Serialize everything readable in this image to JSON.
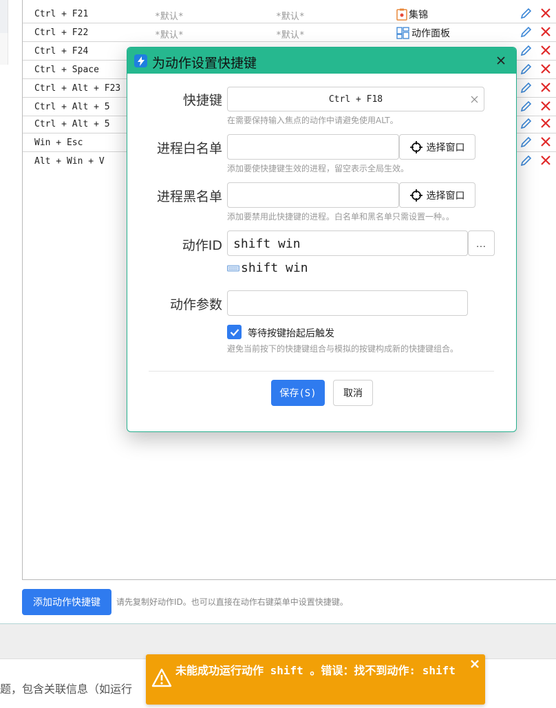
{
  "rows": [
    {
      "key": "Ctrl + F21",
      "default1": "*默认*",
      "default2": "*默认*",
      "action": "集锦",
      "action_icon": "clipboard-icon"
    },
    {
      "key": "Ctrl + F22",
      "default1": "*默认*",
      "default2": "*默认*",
      "action": "动作面板",
      "action_icon": "panel-icon"
    },
    {
      "key": "Ctrl + F24"
    },
    {
      "key": "Ctrl + Space"
    },
    {
      "key": "Ctrl + Alt + F23"
    },
    {
      "key": "Ctrl + Alt + 5"
    },
    {
      "key": "Ctrl + Alt + 5"
    },
    {
      "key": "Win + Esc"
    },
    {
      "key": "Alt + Win + V"
    }
  ],
  "bottom": {
    "add_button": "添加动作快捷键",
    "add_hint": "请先复制好动作ID。也可以直接在动作右键菜单中设置快捷键。",
    "input_text": "题，包含关联信息（如运行"
  },
  "dialog": {
    "title": "为动作设置快捷键",
    "hotkey_label": "快捷键",
    "hotkey_value": "Ctrl + F18",
    "hotkey_hint": "在需要保持输入焦点的动作中请避免使用ALT。",
    "whitelist_label": "进程白名单",
    "whitelist_value": "",
    "whitelist_button": "选择窗口",
    "whitelist_hint": "添加要使快捷键生效的进程，留空表示全局生效。",
    "blacklist_label": "进程黑名单",
    "blacklist_value": "",
    "blacklist_button": "选择窗口",
    "blacklist_hint": "添加要禁用此快捷键的进程。白名单和黑名单只需设置一种。。",
    "action_id_label": "动作ID",
    "action_id_value": "shift win",
    "more_button": "...",
    "action_preview": "shift win",
    "action_params_label": "动作参数",
    "action_params_value": "",
    "wait_release_label": "等待按键抬起后触发",
    "wait_release_checked": true,
    "wait_release_hint": "避免当前按下的快捷键组合与模拟的按键构成新的快捷键组合。",
    "save_button": "保存(S)",
    "cancel_button": "取消"
  },
  "toast": {
    "message": "未能成功运行动作 shift 。错误：找不到动作: shift"
  },
  "colors": {
    "accent": "#2f7bef",
    "dialog_header": "#26b88f",
    "toast_bg": "#f2a007",
    "delete_red": "#e02a2a"
  }
}
